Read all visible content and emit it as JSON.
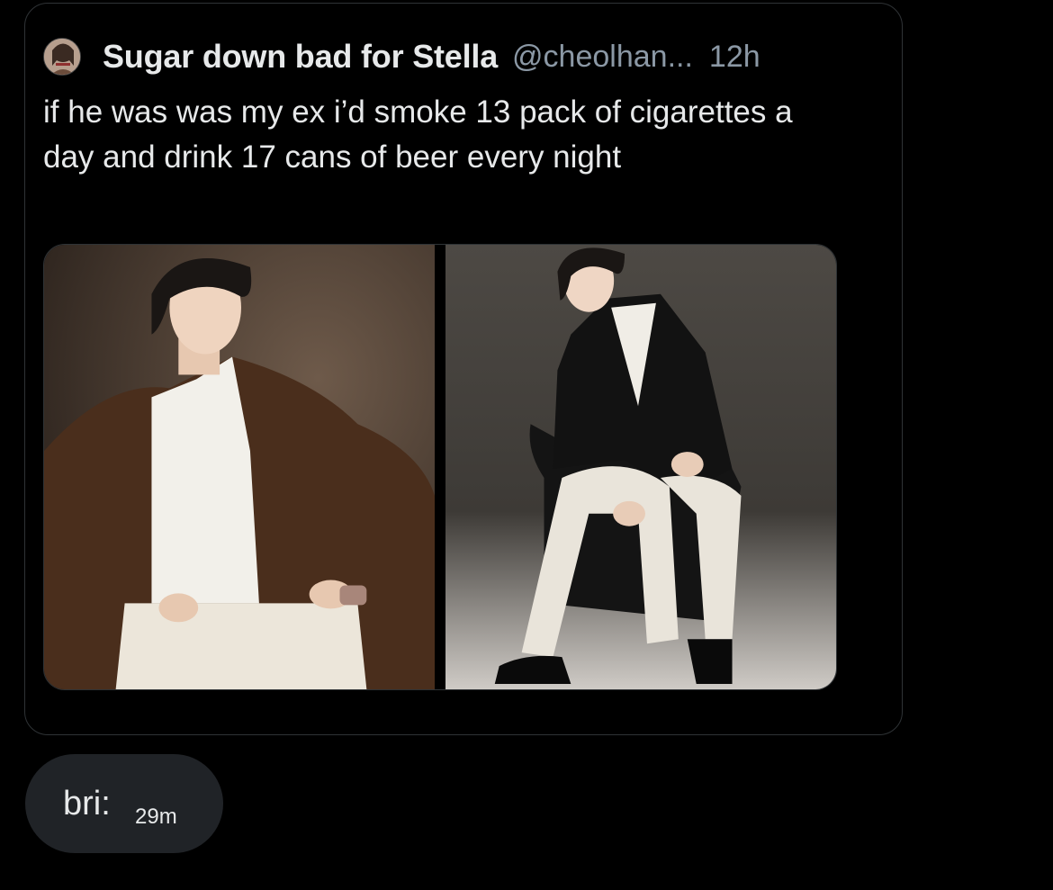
{
  "quoted_tweet": {
    "display_name": "Sugar down bad for Stella",
    "handle": "@cheolhan...",
    "time": "12h",
    "text": "if he was was my ex i’d smoke 13 pack of cigarettes a day and drink 17 cans of beer every night",
    "avatar_icon": "user-avatar",
    "media": [
      {
        "kind": "photo",
        "description_icon": "photo-icon"
      },
      {
        "kind": "photo",
        "description_icon": "photo-icon"
      }
    ]
  },
  "reply": {
    "label": "bri:",
    "time": "29m"
  },
  "colors": {
    "background": "#000000",
    "border": "#2f3336",
    "primary_text": "#e7e9ea",
    "secondary_text": "#8b98a5",
    "bubble": "#202327"
  }
}
